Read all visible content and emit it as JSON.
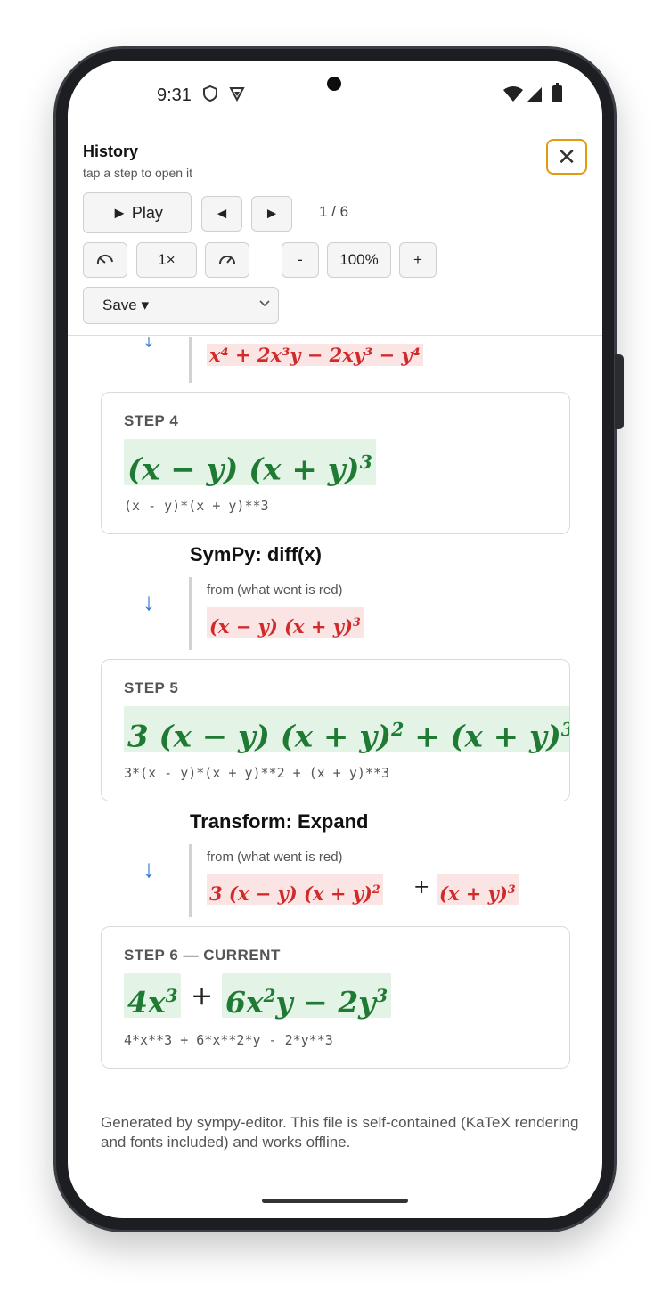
{
  "status": {
    "time": "9:31",
    "icons": [
      "shield-icon",
      "vpn-icon",
      "wifi-icon",
      "signal-icon",
      "battery-icon"
    ]
  },
  "header": {
    "title": "History",
    "subtitle": "tap a step to open it",
    "play_label": "► Play",
    "prev_label": "◄",
    "next_label": "►",
    "counter": "1 / 6",
    "speed_label": "1×",
    "zoom_minus": "-",
    "zoom_value": "100%",
    "zoom_plus": "+",
    "save_label": "Save ▾",
    "close_label": "✕"
  },
  "history": {
    "top_partial_red": "x⁴ + 2x³y − 2xy³ − y⁴",
    "step4": {
      "label": "STEP 4",
      "code": "(x - y)*(x + y)**3"
    },
    "transition1": {
      "title": "SymPy: diff(x)",
      "from": "from (what went is red)"
    },
    "step5": {
      "label": "STEP 5",
      "code": "3*(x - y)*(x + y)**2 + (x + y)**3"
    },
    "transition2": {
      "title": "Transform: Expand",
      "from": "from (what went is red)"
    },
    "step6": {
      "label": "STEP 6 — CURRENT",
      "code": "4*x**3 + 6*x**2*y - 2*y**3"
    }
  },
  "footer": "Generated by sympy-editor. This file is self-contained (KaTeX rendering and fonts included) and works offline."
}
